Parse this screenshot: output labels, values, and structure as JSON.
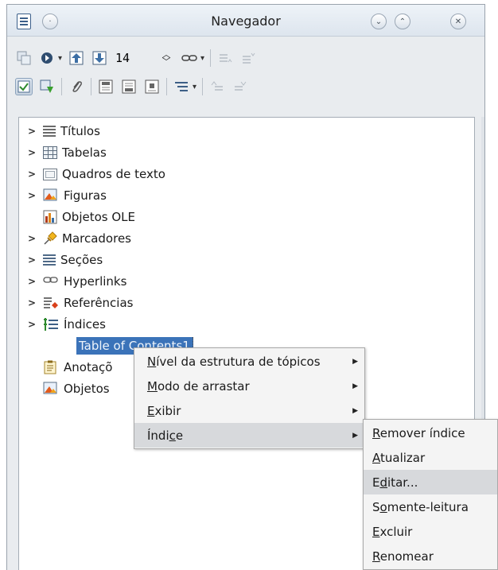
{
  "window": {
    "title": "Navegador"
  },
  "toolbar": {
    "spin_value": "14"
  },
  "tree": {
    "items": [
      {
        "label": "Títulos",
        "icon": "headings-icon",
        "expandable": true
      },
      {
        "label": "Tabelas",
        "icon": "table-icon",
        "expandable": true
      },
      {
        "label": "Quadros de texto",
        "icon": "text-frame-icon",
        "expandable": true
      },
      {
        "label": "Figuras",
        "icon": "image-icon",
        "expandable": true
      },
      {
        "label": "Objetos OLE",
        "icon": "ole-object-icon",
        "expandable": false
      },
      {
        "label": "Marcadores",
        "icon": "bookmark-icon",
        "expandable": true
      },
      {
        "label": "Seções",
        "icon": "section-icon",
        "expandable": true
      },
      {
        "label": "Hyperlinks",
        "icon": "hyperlink-icon",
        "expandable": true
      },
      {
        "label": "Referências",
        "icon": "reference-icon",
        "expandable": true
      },
      {
        "label": "Índices",
        "icon": "index-icon",
        "expandable": true
      }
    ],
    "child_selected": "Table of Contents1",
    "after": [
      {
        "label": "Anotaçõ",
        "icon": "comment-icon"
      },
      {
        "label": "Objetos",
        "icon": "drawing-object-icon"
      }
    ]
  },
  "context_menu": {
    "items": [
      {
        "pre": "",
        "ul": "N",
        "post": "ível da estrutura de tópicos",
        "submenu": true
      },
      {
        "pre": "",
        "ul": "M",
        "post": "odo de arrastar",
        "submenu": true
      },
      {
        "pre": "",
        "ul": "E",
        "post": "xibir",
        "submenu": true
      },
      {
        "pre": "Índi",
        "ul": "c",
        "post": "e",
        "submenu": true
      }
    ]
  },
  "submenu": {
    "items": [
      {
        "pre": "",
        "ul": "R",
        "post": "emover índice"
      },
      {
        "pre": "",
        "ul": "A",
        "post": "tualizar"
      },
      {
        "pre": "E",
        "ul": "d",
        "post": "itar..."
      },
      {
        "pre": "S",
        "ul": "o",
        "post": "mente-leitura"
      },
      {
        "pre": "",
        "ul": "E",
        "post": "xcluir"
      },
      {
        "pre": "",
        "ul": "R",
        "post": "enomear"
      }
    ]
  },
  "colors": {
    "selection": "#3b73b9",
    "menu_highlight": "#d7d9dc"
  }
}
